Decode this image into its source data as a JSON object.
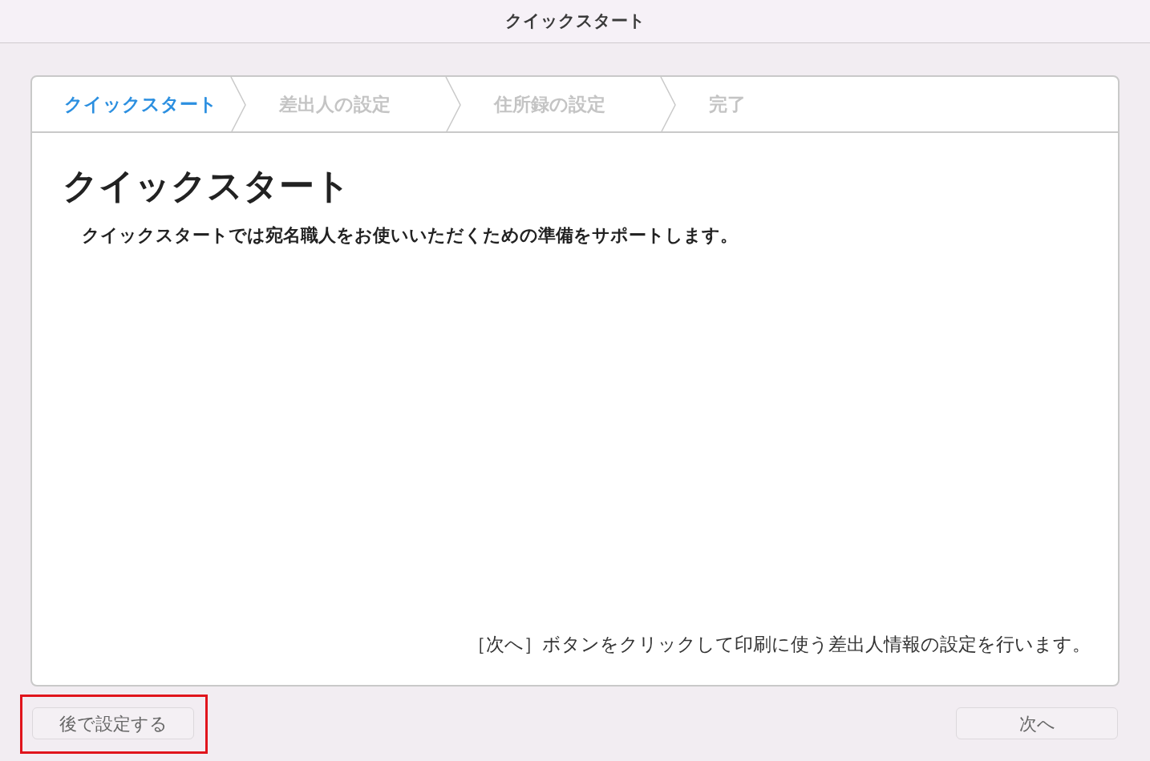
{
  "window": {
    "title": "クイックスタート"
  },
  "steps": [
    {
      "label": "クイックスタート",
      "selected": true
    },
    {
      "label": "差出人の設定",
      "selected": false
    },
    {
      "label": "住所録の設定",
      "selected": false
    },
    {
      "label": "完了",
      "selected": false
    }
  ],
  "content": {
    "heading": "クイックスタート",
    "description": "クイックスタートでは宛名職人をお使いいただくための準備をサポートします。",
    "hint": "［次へ］ボタンをクリックして印刷に使う差出人情報の設定を行います。"
  },
  "buttons": {
    "later": {
      "label": "後で設定する",
      "highlighted": true
    },
    "next": {
      "label": "次へ"
    }
  }
}
